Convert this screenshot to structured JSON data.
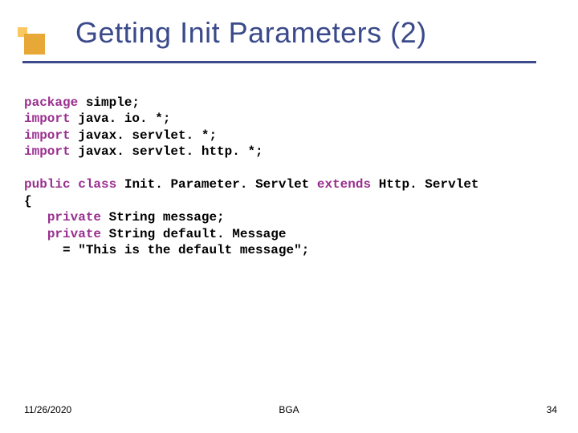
{
  "title": "Getting Init Parameters (2)",
  "code": {
    "kw_package": "package",
    "pkg_name": " simple;",
    "kw_import1": "import",
    "import1": " java. io. *;",
    "kw_import2": "import",
    "import2": " javax. servlet. *;",
    "kw_import3": "import",
    "import3": " javax. servlet. http. *;",
    "kw_public": "public",
    "sp1": " ",
    "kw_class": "class",
    "classname": " Init. Parameter. Servlet ",
    "kw_extends": "extends",
    "supername": " Http. Servlet",
    "brace_open": "{",
    "indent1": "   ",
    "kw_private1": "private",
    "field1": " String message;",
    "indent2": "   ",
    "kw_private2": "private",
    "field2": " String default. Message",
    "indent3": "     ",
    "assign": "= \"This is the default message\";"
  },
  "footer": {
    "date": "11/26/2020",
    "center": "BGA",
    "page": "34"
  }
}
